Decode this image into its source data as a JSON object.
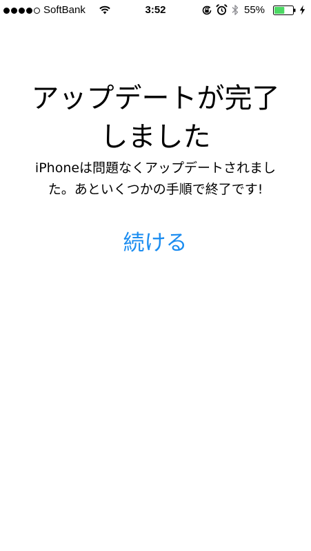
{
  "status_bar": {
    "carrier": "SoftBank",
    "time": "3:52",
    "battery_percent": "55%",
    "battery_level": 0.55,
    "signal_bars_filled": 4,
    "signal_bars_total": 5,
    "icons": [
      "wifi-icon",
      "rotation-lock-icon",
      "alarm-icon",
      "bluetooth-icon",
      "battery-icon",
      "charging-icon"
    ]
  },
  "main": {
    "title": "アップデートが完了\nしました",
    "message": "iPhoneは問題なくアップデートされまし\nた。あといくつかの手順で終了です!",
    "continue_label": "続ける"
  },
  "colors": {
    "accent": "#1a8cf0",
    "battery_fill": "#4cd964"
  }
}
